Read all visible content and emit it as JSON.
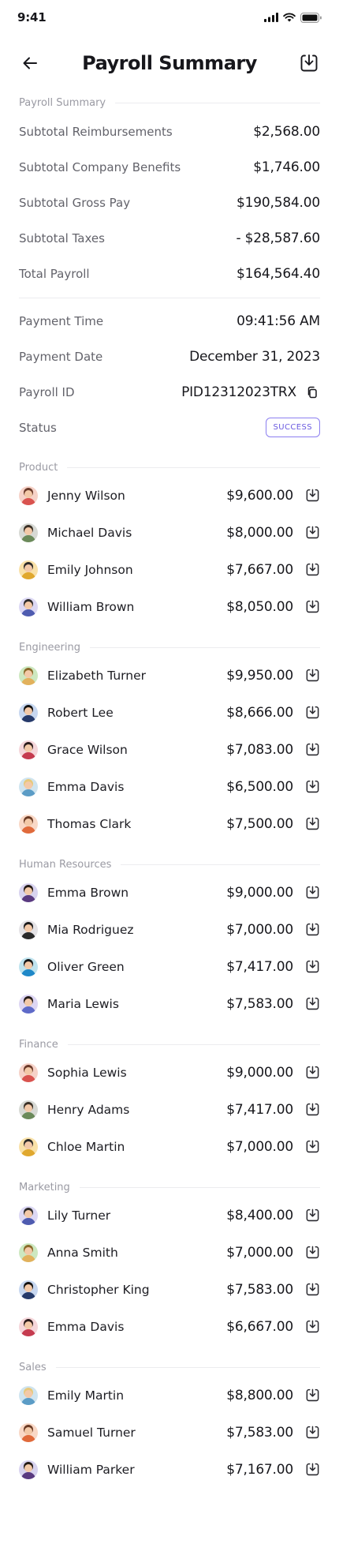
{
  "status_bar": {
    "time": "9:41"
  },
  "header": {
    "title": "Payroll Summary"
  },
  "summary": {
    "section_label": "Payroll Summary",
    "rows": [
      {
        "label": "Subtotal Reimbursements",
        "value": "$2,568.00"
      },
      {
        "label": "Subtotal Company Benefits",
        "value": "$1,746.00"
      },
      {
        "label": "Subtotal Gross Pay",
        "value": "$190,584.00"
      },
      {
        "label": "Subtotal Taxes",
        "value": "- $28,587.60"
      },
      {
        "label": "Total Payroll",
        "value": "$164,564.40"
      }
    ]
  },
  "payment": {
    "time_label": "Payment Time",
    "time_value": "09:41:56 AM",
    "date_label": "Payment Date",
    "date_value": "December 31, 2023",
    "id_label": "Payroll ID",
    "id_value": "PID12312023TRX",
    "status_label": "Status",
    "status_value": "SUCCESS"
  },
  "colors": {
    "accent": "#6a5ae0",
    "text": "#17171c",
    "muted": "#9a9aa3"
  },
  "groups": [
    {
      "label": "Product",
      "people": [
        {
          "name": "Jenny Wilson",
          "amount": "$9,600.00"
        },
        {
          "name": "Michael Davis",
          "amount": "$8,000.00"
        },
        {
          "name": "Emily Johnson",
          "amount": "$7,667.00"
        },
        {
          "name": "William Brown",
          "amount": "$8,050.00"
        }
      ]
    },
    {
      "label": "Engineering",
      "people": [
        {
          "name": "Elizabeth Turner",
          "amount": "$9,950.00"
        },
        {
          "name": "Robert Lee",
          "amount": "$8,666.00"
        },
        {
          "name": "Grace Wilson",
          "amount": "$7,083.00"
        },
        {
          "name": "Emma Davis",
          "amount": "$6,500.00"
        },
        {
          "name": "Thomas Clark",
          "amount": "$7,500.00"
        }
      ]
    },
    {
      "label": "Human Resources",
      "people": [
        {
          "name": "Emma Brown",
          "amount": "$9,000.00"
        },
        {
          "name": "Mia Rodriguez",
          "amount": "$7,000.00"
        },
        {
          "name": "Oliver Green",
          "amount": "$7,417.00"
        },
        {
          "name": "Maria Lewis",
          "amount": "$7,583.00"
        }
      ]
    },
    {
      "label": "Finance",
      "people": [
        {
          "name": "Sophia Lewis",
          "amount": "$9,000.00"
        },
        {
          "name": "Henry Adams",
          "amount": "$7,417.00"
        },
        {
          "name": "Chloe Martin",
          "amount": "$7,000.00"
        }
      ]
    },
    {
      "label": "Marketing",
      "people": [
        {
          "name": "Lily Turner",
          "amount": "$8,400.00"
        },
        {
          "name": "Anna Smith",
          "amount": "$7,000.00"
        },
        {
          "name": "Christopher King",
          "amount": "$7,583.00"
        },
        {
          "name": "Emma Davis",
          "amount": "$6,667.00"
        }
      ]
    },
    {
      "label": "Sales",
      "people": [
        {
          "name": "Emily Martin",
          "amount": "$8,800.00"
        },
        {
          "name": "Samuel Turner",
          "amount": "$7,583.00"
        },
        {
          "name": "William Parker",
          "amount": "$7,167.00"
        }
      ]
    }
  ]
}
